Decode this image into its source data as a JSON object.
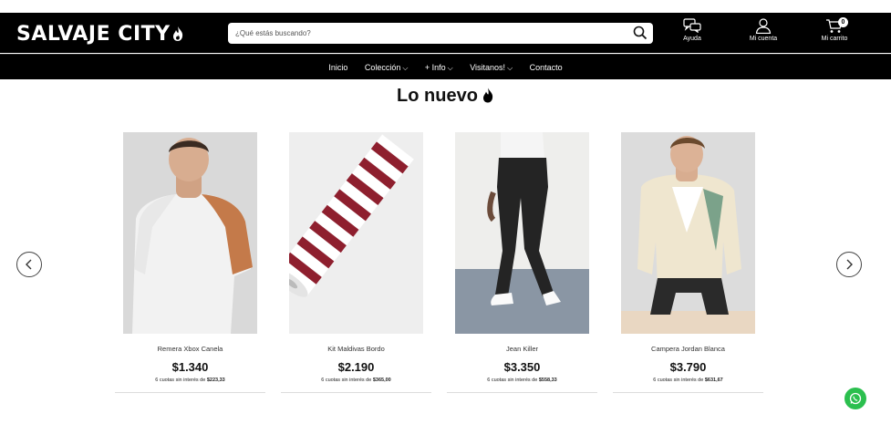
{
  "header": {
    "logo_text": "SALVAJE CITY",
    "search": {
      "placeholder": "¿Qué estás buscando?"
    },
    "help_label": "Ayuda",
    "account_label": "Mi cuenta",
    "cart_label": "Mi carrito",
    "cart_count": "0"
  },
  "nav": {
    "items": [
      {
        "label": "Inicio"
      },
      {
        "label": "Colección",
        "chevron": "⌵"
      },
      {
        "label": "+ Info",
        "chevron": "⌵"
      },
      {
        "label": "Visitanos!",
        "chevron": "⌵"
      },
      {
        "label": "Contacto"
      }
    ]
  },
  "section": {
    "title": "Lo nuevo"
  },
  "products": [
    {
      "name": "Remera Xbox Canela",
      "price": "$1.340",
      "installments_prefix": "6 cuotas sin interés de ",
      "installment_amount": "$223,33"
    },
    {
      "name": "Kit Maldivas Bordo",
      "price": "$2.190",
      "installments_prefix": "6 cuotas sin interés de ",
      "installment_amount": "$365,00"
    },
    {
      "name": "Jean Killer",
      "price": "$3.350",
      "installments_prefix": "6 cuotas sin interés de ",
      "installment_amount": "$558,33"
    },
    {
      "name": "Campera Jordan Blanca",
      "price": "$3.790",
      "installments_prefix": "6 cuotas sin interés de ",
      "installment_amount": "$631,67"
    }
  ],
  "icons": {
    "logo": "flame-icon",
    "search": "search-icon",
    "help": "chat-bubbles-icon",
    "account": "user-icon",
    "cart": "cart-icon",
    "title": "flame-icon",
    "prev": "chevron-left-icon",
    "next": "chevron-right-icon",
    "whatsapp": "whatsapp-icon"
  },
  "colors": {
    "header_bg": "#000000",
    "whatsapp": "#2bbf4e"
  }
}
